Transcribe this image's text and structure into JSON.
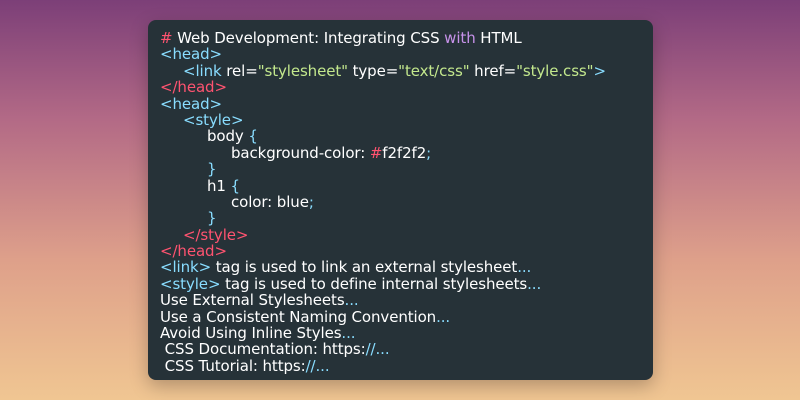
{
  "editor": {
    "title": {
      "hash": "#",
      "text1": " Web Development: Integrating CSS ",
      "kw": "with",
      "text2": " HTML"
    },
    "l1": "<head>",
    "l2": {
      "open": "<link",
      "a1": " rel=",
      "v1": "\"stylesheet\"",
      "a2": " type=",
      "v2": "\"text/css\"",
      "a3": " href=",
      "v3": "\"style.css\"",
      "close": ">"
    },
    "l3": "</head>",
    "l4": "<head>",
    "l5": "<style>",
    "l6": {
      "sel": "body ",
      "brace": "{"
    },
    "l7": {
      "prop": "background-color: ",
      "hash": "#",
      "val": "f2f2f2",
      "semi": ";"
    },
    "l8": "}",
    "l9": {
      "sel": "h1 ",
      "brace": "{"
    },
    "l10": {
      "prop": "color: blue",
      "semi": ";"
    },
    "l11": "}",
    "l12": "</style>",
    "l13": "</head>",
    "l14": {
      "tag": "<link>",
      "text": " tag is used to link an external stylesheet",
      "ell": "..."
    },
    "l15": {
      "tag": "<style>",
      "text": " tag is used to define internal stylesheets",
      "ell": "..."
    },
    "l16": {
      "text": "Use External Stylesheets",
      "ell": "..."
    },
    "l17": {
      "text": "Use a Consistent Naming Convention",
      "ell": "..."
    },
    "l18": {
      "text": "Avoid Using Inline Styles",
      "ell": "..."
    },
    "l19": {
      "text": " CSS Documentation: https:",
      "slashes": "//",
      "ell": "..."
    },
    "l20": {
      "text": " CSS Tutorial: https:",
      "slashes": "//",
      "ell": "..."
    }
  }
}
